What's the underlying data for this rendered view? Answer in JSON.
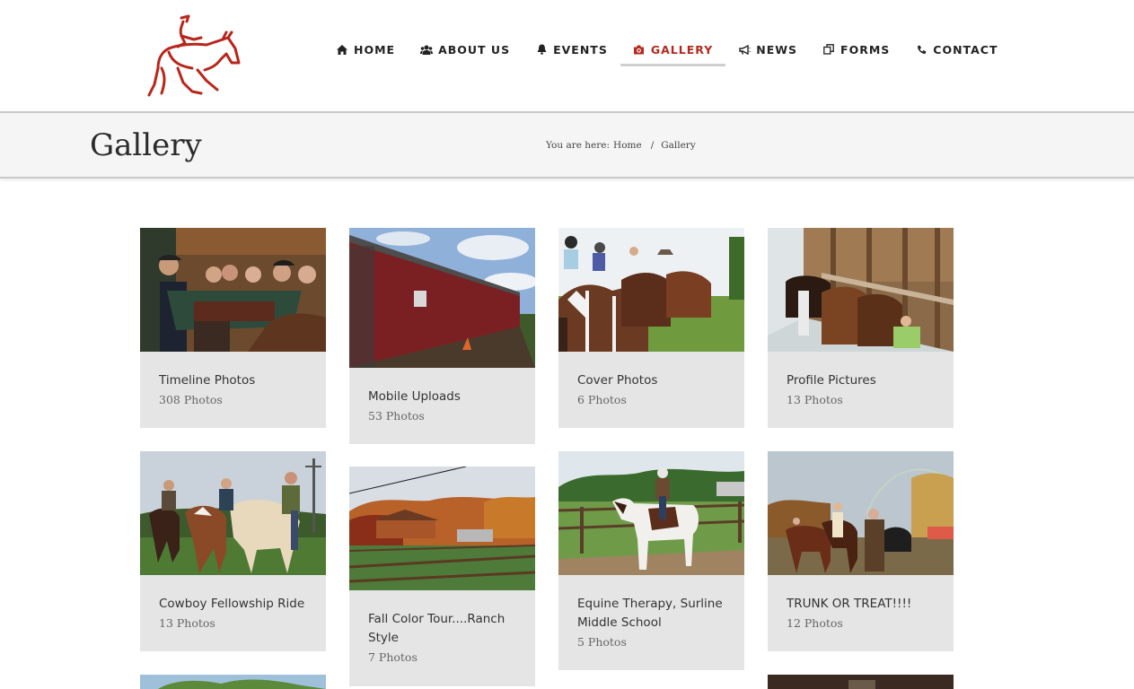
{
  "nav": [
    {
      "label": "HOME",
      "icon": "home-icon",
      "active": false
    },
    {
      "label": "ABOUT US",
      "icon": "users-icon",
      "active": false
    },
    {
      "label": "EVENTS",
      "icon": "bell-icon",
      "active": false
    },
    {
      "label": "GALLERY",
      "icon": "camera-icon",
      "active": true
    },
    {
      "label": "NEWS",
      "icon": "megaphone-icon",
      "active": false
    },
    {
      "label": "FORMS",
      "icon": "copy-icon",
      "active": false
    },
    {
      "label": "CONTACT",
      "icon": "phone-icon",
      "active": false
    }
  ],
  "colors": {
    "accent": "#b22a1f",
    "card_bg": "#e5e5e5",
    "titlebar_bg": "#f5f5f5"
  },
  "page": {
    "title": "Gallery"
  },
  "breadcrumb": {
    "prefix": "You are here:",
    "home": "Home",
    "separator": "/",
    "current": "Gallery"
  },
  "albums": [
    {
      "name": "Timeline Photos",
      "count": "308 Photos"
    },
    {
      "name": "Mobile Uploads",
      "count": "53 Photos"
    },
    {
      "name": "Cover Photos",
      "count": "6 Photos"
    },
    {
      "name": "Profile Pictures",
      "count": "13 Photos"
    },
    {
      "name": "Cowboy Fellowship Ride",
      "count": "13 Photos"
    },
    {
      "name": "Fall Color Tour....Ranch Style",
      "count": "7 Photos"
    },
    {
      "name": "Equine Therapy, Surline Middle School",
      "count": "5 Photos"
    },
    {
      "name": "TRUNK OR TREAT!!!!",
      "count": "12 Photos"
    }
  ]
}
